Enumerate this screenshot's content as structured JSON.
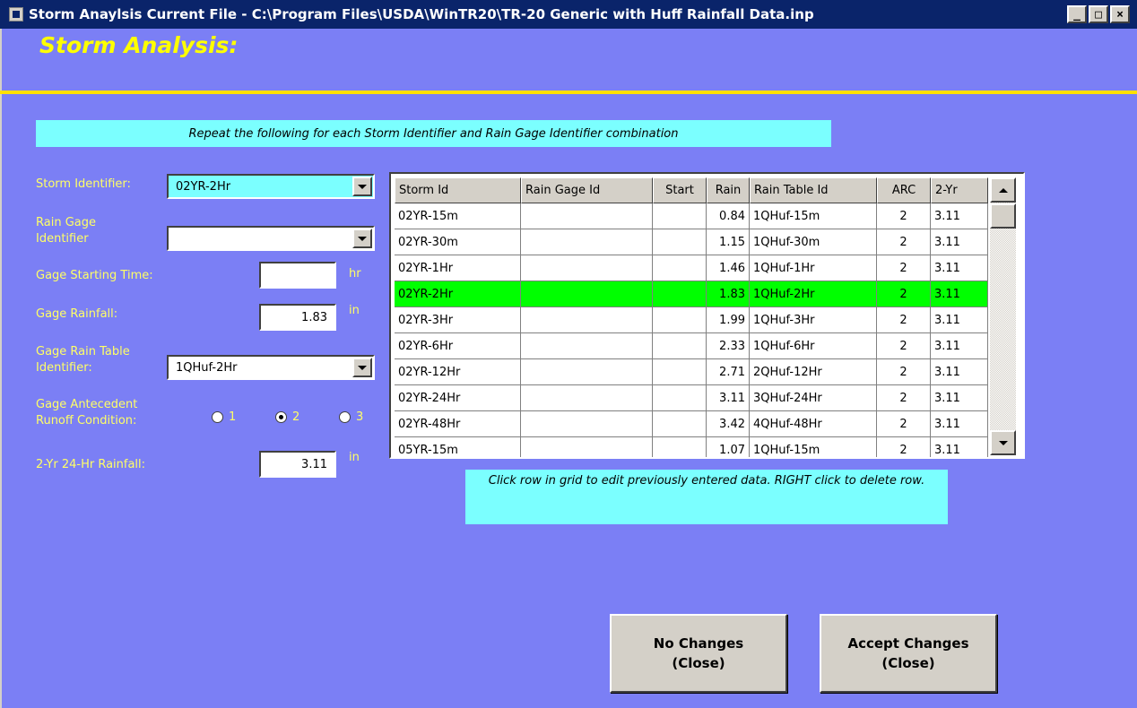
{
  "window": {
    "title": "Storm Anaylsis  Current File - C:\\Program Files\\USDA\\WinTR20\\TR-20 Generic with Huff Rainfall Data.inp",
    "minimize": "_",
    "maximize": "□",
    "close": "×"
  },
  "heading": "Storm Analysis:",
  "banner": "Repeat the following for each Storm Identifier and Rain Gage Identifier combination",
  "form": {
    "storm_identifier_label": "Storm Identifier:",
    "storm_identifier_value": "02YR-2Hr",
    "rain_gage_label_1": "Rain Gage",
    "rain_gage_label_2": "Identifier",
    "rain_gage_value": "",
    "gage_start_label": "Gage Starting Time:",
    "gage_start_value": "",
    "gage_start_unit": "hr",
    "gage_rainfall_label": "Gage Rainfall:",
    "gage_rainfall_value": "1.83",
    "gage_rainfall_unit": "in",
    "rain_table_label_1": "Gage Rain Table",
    "rain_table_label_2": "Identifier:",
    "rain_table_value": "1QHuf-2Hr",
    "arc_label_1": "Gage Antecedent",
    "arc_label_2": "Runoff Condition:",
    "arc_options": [
      "1",
      "2",
      "3"
    ],
    "arc_selected": "2",
    "two_yr_label": "2-Yr 24-Hr Rainfall:",
    "two_yr_value": "3.11",
    "two_yr_unit": "in"
  },
  "grid": {
    "headers": [
      "Storm Id",
      "Rain Gage Id",
      "Start",
      "Rain",
      "Rain Table Id",
      "ARC",
      "2-Yr"
    ],
    "selected_row": 3,
    "rows": [
      [
        "02YR-15m",
        "",
        "",
        "0.84",
        "1QHuf-15m",
        "2",
        "3.11"
      ],
      [
        "02YR-30m",
        "",
        "",
        "1.15",
        "1QHuf-30m",
        "2",
        "3.11"
      ],
      [
        "02YR-1Hr",
        "",
        "",
        "1.46",
        "1QHuf-1Hr",
        "2",
        "3.11"
      ],
      [
        "02YR-2Hr",
        "",
        "",
        "1.83",
        "1QHuf-2Hr",
        "2",
        "3.11"
      ],
      [
        "02YR-3Hr",
        "",
        "",
        "1.99",
        "1QHuf-3Hr",
        "2",
        "3.11"
      ],
      [
        "02YR-6Hr",
        "",
        "",
        "2.33",
        "1QHuf-6Hr",
        "2",
        "3.11"
      ],
      [
        "02YR-12Hr",
        "",
        "",
        "2.71",
        "2QHuf-12Hr",
        "2",
        "3.11"
      ],
      [
        "02YR-24Hr",
        "",
        "",
        "3.11",
        "3QHuf-24Hr",
        "2",
        "3.11"
      ],
      [
        "02YR-48Hr",
        "",
        "",
        "3.42",
        "4QHuf-48Hr",
        "2",
        "3.11"
      ],
      [
        "05YR-15m",
        "",
        "",
        "1.07",
        "1QHuf-15m",
        "2",
        "3.11"
      ]
    ]
  },
  "note": "Click row in grid to edit previously entered data.  RIGHT click to delete row.",
  "buttons": {
    "no_changes_line1": "No Changes",
    "no_changes_line2": "(Close)",
    "accept_line1": "Accept Changes",
    "accept_line2": "(Close)"
  }
}
